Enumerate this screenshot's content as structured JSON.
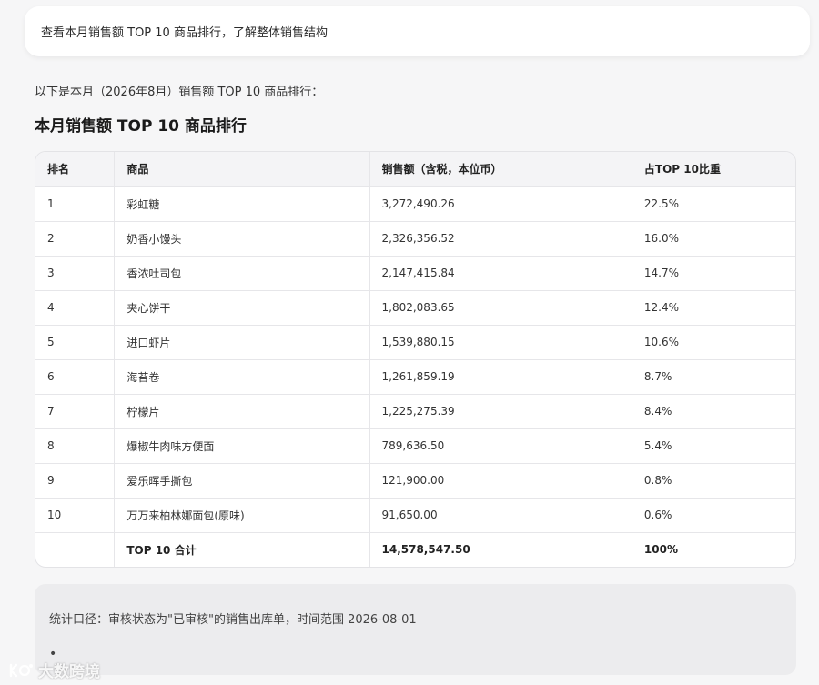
{
  "user_message": "查看本月销售额 TOP 10 商品排行，了解整体销售结构",
  "intro": "以下是本月（2026年8月）销售额 TOP 10 商品排行：",
  "heading": "本月销售额 TOP 10 商品排行",
  "table": {
    "headers": [
      "排名",
      "商品",
      "销售额（含税，本位币）",
      "占TOP 10比重"
    ],
    "rows": [
      [
        "1",
        "彩虹糖",
        "3,272,490.26",
        "22.5%"
      ],
      [
        "2",
        "奶香小馒头",
        "2,326,356.52",
        "16.0%"
      ],
      [
        "3",
        "香浓吐司包",
        "2,147,415.84",
        "14.7%"
      ],
      [
        "4",
        "夹心饼干",
        "1,802,083.65",
        "12.4%"
      ],
      [
        "5",
        "进口虾片",
        "1,539,880.15",
        "10.6%"
      ],
      [
        "6",
        "海苔卷",
        "1,261,859.19",
        "8.7%"
      ],
      [
        "7",
        "柠檬片",
        "1,225,275.39",
        "8.4%"
      ],
      [
        "8",
        "爆椒牛肉味方便面",
        "789,636.50",
        "5.4%"
      ],
      [
        "9",
        "爱乐晖手撕包",
        "121,900.00",
        "0.8%"
      ],
      [
        "10",
        "万万来柏林娜面包(原味)",
        "91,650.00",
        "0.6%"
      ]
    ],
    "total": [
      "",
      "TOP 10 合计",
      "14,578,547.50",
      "100%"
    ]
  },
  "note": "统计口径：审核状态为\"已审核\"的销售出库单，时间范围 2026-08-01",
  "note_bullet": "•",
  "watermark": "大数跨境"
}
